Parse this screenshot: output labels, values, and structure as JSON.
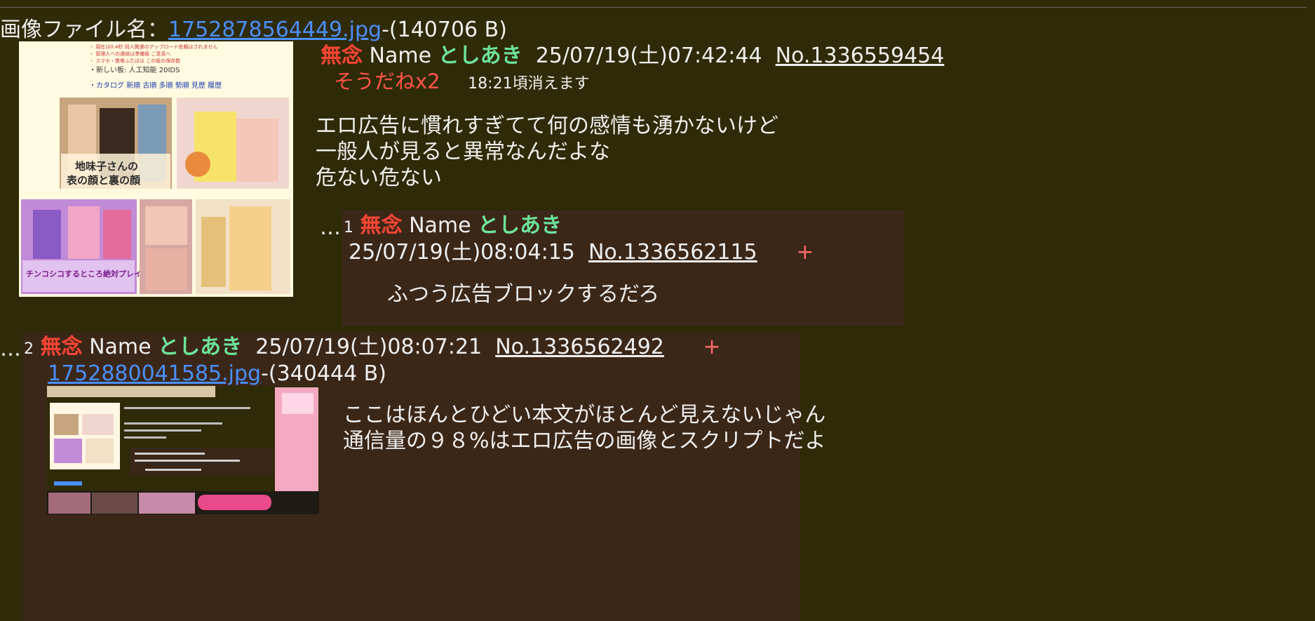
{
  "op": {
    "file_label": "画像ファイル名：",
    "file_name": "1752878564449.jpg",
    "file_size": "-(140706 B)",
    "subject": "無念",
    "name_label": "Name",
    "handle": "としあき",
    "datetime": "25/07/19(土)07:42:44",
    "post_no": "No.1336559454",
    "sodane": "そうだねx2",
    "expire": "18:21頃消えます",
    "body": [
      "エロ広告に慣れすぎてて何の感情も湧かないけど",
      "一般人が見ると異常なんだよな",
      "危ない危ない"
    ],
    "thumbnail": {
      "top_bullets": [
        "・カタログ 新順 古順 多順 勢順 見歴 履歴"
      ],
      "new_board": "・新しい板: 人工知能 20IDS",
      "ad1_title": "地味子さんの",
      "ad1_title2": "表の顔と裏の顔",
      "ad3_caption": "チンコシコするところ絶対プレイしてください"
    }
  },
  "replies": [
    {
      "index": "1",
      "subject": "無念",
      "name_label": "Name",
      "handle": "としあき",
      "datetime": "25/07/19(土)08:04:15",
      "post_no": "No.1336562115",
      "plus": "+",
      "body": [
        "ふつう広告ブロックするだろ"
      ]
    },
    {
      "index": "2",
      "subject": "無念",
      "name_label": "Name",
      "handle": "としあき",
      "datetime": "25/07/19(土)08:07:21",
      "post_no": "No.1336562492",
      "plus": "+",
      "file_name": "1752880041585.jpg",
      "file_size": "-(340444 B)",
      "body": [
        "ここはほんとひどい本文がほとんど見えないじゃん",
        "通信量の９８%はエロ広告の画像とスクリプトだよ"
      ]
    }
  ],
  "ellipsis": "…",
  "colors": {
    "background": "#2f2a07",
    "reply_background": "#3b2718",
    "link": "#4a8fff",
    "subject": "#ff4533",
    "handle": "#6ee29a"
  }
}
